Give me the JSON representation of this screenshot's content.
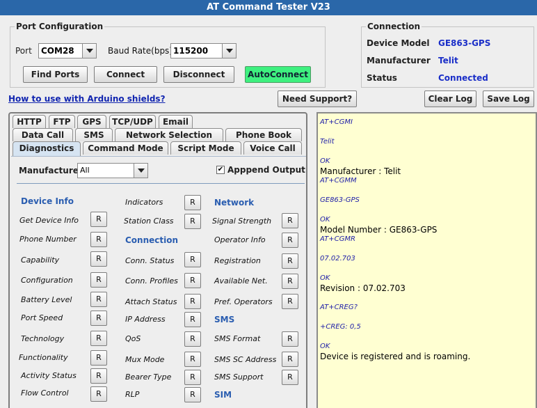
{
  "window": {
    "title": "AT Command Tester V23"
  },
  "port_config": {
    "title": "Port Configuration",
    "port_label": "Port",
    "port_value": "COM28",
    "baud_label": "Baud Rate(bps)",
    "baud_value": "115200",
    "buttons": {
      "find_ports": "Find Ports",
      "connect": "Connect",
      "disconnect": "Disconnect",
      "autoconnect": "AutoConnect"
    },
    "autoconnect_color": "#3ef07f"
  },
  "connection": {
    "title": "Connection",
    "device_model_label": "Device Model",
    "device_model_value": "GE863-GPS",
    "manufacturer_label": "Manufacturer",
    "manufacturer_value": "Telit",
    "status_label": "Status",
    "status_value": "Connected"
  },
  "toolbar": {
    "arduino_link": "How to use with Arduino shields?",
    "need_support": "Need Support?",
    "clear_log": "Clear Log",
    "save_log": "Save Log"
  },
  "tabs": {
    "row1": [
      "HTTP",
      "FTP",
      "GPS",
      "TCP/UDP",
      "Email"
    ],
    "row2": [
      "Data Call",
      "SMS",
      "Network Selection",
      "Phone Book"
    ],
    "row3": [
      "Diagnostics",
      "Command Mode",
      "Script Mode",
      "Voice Call"
    ],
    "active": "Diagnostics"
  },
  "diagnostics": {
    "manufacturer_label": "Manufacturer",
    "manufacturer_value": "All",
    "append_output_label": "Apppend Output",
    "append_output_checked": true,
    "r_label": "R",
    "col1": {
      "section": "Device Info",
      "items": [
        "Get Device Info",
        "Phone Number",
        "Capability",
        "Configuration",
        "Battery Level",
        "Port Speed",
        "Technology",
        "Functionality",
        "Activity Status",
        "Flow Control"
      ]
    },
    "col2": {
      "items_top": [
        "Indicators",
        "Station Class"
      ],
      "section": "Connection",
      "items": [
        "Conn. Status",
        "Conn. Profiles",
        "Attach Status",
        "IP Address",
        "QoS",
        "Mux Mode",
        "Bearer Type",
        "RLP"
      ]
    },
    "col3": {
      "section": "Network",
      "items": [
        "Signal Strength",
        "Operator Info",
        "Registration",
        "Available Net.",
        "Pref. Operators"
      ],
      "section2": "SMS",
      "items2": [
        "SMS Format",
        "SMS SC Address",
        "SMS Support"
      ],
      "section3": "SIM"
    }
  },
  "log": [
    {
      "t": "AT+CGMI",
      "k": "cmd"
    },
    {
      "t": "",
      "k": "cmd"
    },
    {
      "t": "Telit",
      "k": "cmd"
    },
    {
      "t": "",
      "k": "cmd"
    },
    {
      "t": "OK",
      "k": "cmd"
    },
    {
      "t": "Manufacturer : Telit",
      "k": "res"
    },
    {
      "t": "AT+CGMM",
      "k": "cmd"
    },
    {
      "t": "",
      "k": "cmd"
    },
    {
      "t": "GE863-GPS",
      "k": "cmd"
    },
    {
      "t": "",
      "k": "cmd"
    },
    {
      "t": "OK",
      "k": "cmd"
    },
    {
      "t": "Model Number : GE863-GPS",
      "k": "res"
    },
    {
      "t": "AT+CGMR",
      "k": "cmd"
    },
    {
      "t": "",
      "k": "cmd"
    },
    {
      "t": "07.02.703",
      "k": "cmd"
    },
    {
      "t": "",
      "k": "cmd"
    },
    {
      "t": "OK",
      "k": "cmd"
    },
    {
      "t": "Revision : 07.02.703",
      "k": "res"
    },
    {
      "t": "",
      "k": "cmd"
    },
    {
      "t": "AT+CREG?",
      "k": "cmd"
    },
    {
      "t": "",
      "k": "cmd"
    },
    {
      "t": "+CREG: 0,5",
      "k": "cmd"
    },
    {
      "t": "",
      "k": "cmd"
    },
    {
      "t": "OK",
      "k": "cmd"
    },
    {
      "t": "Device is registered and is roaming.",
      "k": "res"
    }
  ]
}
